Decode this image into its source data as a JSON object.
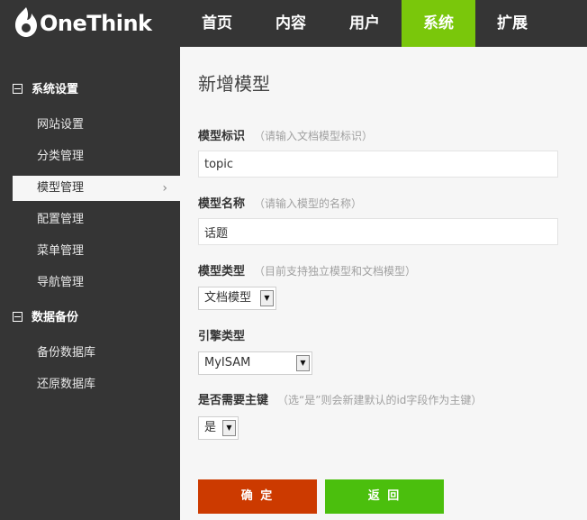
{
  "brand": {
    "name": "OneThink"
  },
  "nav": [
    {
      "label": "首页",
      "active": false
    },
    {
      "label": "内容",
      "active": false
    },
    {
      "label": "用户",
      "active": false
    },
    {
      "label": "系统",
      "active": true
    },
    {
      "label": "扩展",
      "active": false
    }
  ],
  "sidebar": {
    "groups": [
      {
        "title": "系统设置",
        "items": [
          "网站设置",
          "分类管理",
          "模型管理",
          "配置管理",
          "菜单管理",
          "导航管理"
        ]
      },
      {
        "title": "数据备份",
        "items": [
          "备份数据库",
          "还原数据库"
        ]
      }
    ],
    "active_item": "模型管理"
  },
  "main": {
    "title": "新增模型",
    "fields": {
      "identifier": {
        "label": "模型标识",
        "hint": "（请输入文档模型标识）",
        "value": "topic"
      },
      "name": {
        "label": "模型名称",
        "hint": "（请输入模型的名称）",
        "value": "话题"
      },
      "type": {
        "label": "模型类型",
        "hint": "（目前支持独立模型和文档模型）",
        "value": "文档模型"
      },
      "engine": {
        "label": "引擎类型",
        "value": "MyISAM"
      },
      "primary_key": {
        "label": "是否需要主键",
        "hint": "（选“是”则会新建默认的id字段作为主键）",
        "value": "是"
      }
    },
    "buttons": {
      "confirm": "确 定",
      "back": "返 回"
    }
  },
  "colors": {
    "topbar": "#353535",
    "nav_active": "#7ac70b",
    "confirm": "#cc3a00",
    "back": "#4bbf0d"
  }
}
